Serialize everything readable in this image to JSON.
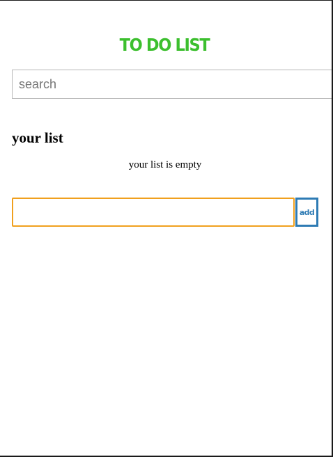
{
  "header": {
    "title": "TO DO LIST",
    "title_color": "#3cbf2e"
  },
  "search": {
    "placeholder": "search",
    "value": ""
  },
  "list": {
    "heading": "your list",
    "empty_message": "your list is empty",
    "items": []
  },
  "add_form": {
    "input_value": "",
    "input_border_color": "#f0a01e",
    "button_label": "add",
    "button_color": "#2e7bb4"
  }
}
